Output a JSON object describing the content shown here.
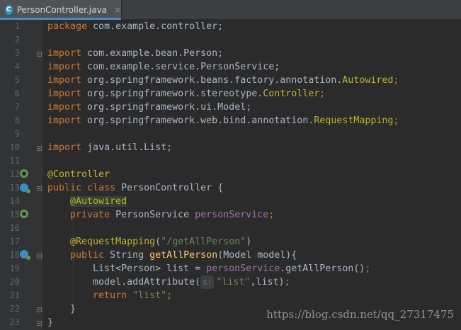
{
  "tab": {
    "icon": "C",
    "label": "PersonController.java",
    "close": "×"
  },
  "code": {
    "line_numbers": [
      "1",
      "2",
      "3",
      "4",
      "5",
      "6",
      "7",
      "8",
      "9",
      "10",
      "11",
      "12",
      "13",
      "14",
      "15",
      "16",
      "17",
      "18",
      "19",
      "20",
      "21",
      "22",
      "23"
    ],
    "l1": {
      "kw": "package",
      "rest": " com.example.controller;"
    },
    "l3": {
      "kw": "import",
      "rest": " com.example.bean.Person;"
    },
    "l4": {
      "kw": "import",
      "rest": " com.example.service.PersonService;"
    },
    "l5": {
      "kw": "import",
      "rest": " org.springframework.beans.factory.annotation.",
      "cls": "Autowired",
      "end": ";"
    },
    "l6": {
      "kw": "import",
      "rest": " org.springframework.stereotype.",
      "cls": "Controller",
      "end": ";"
    },
    "l7": {
      "kw": "import",
      "rest": " org.springframework.ui.Model;"
    },
    "l8": {
      "kw": "import",
      "rest": " org.springframework.web.bind.annotation.",
      "cls": "RequestMapping",
      "end": ";"
    },
    "l10": {
      "kw": "import",
      "rest": " java.util.List;"
    },
    "l12": {
      "ann": "@Controller"
    },
    "l13": {
      "kw1": "public",
      "kw2": " class",
      "rest": " PersonController {"
    },
    "l14": {
      "ann": "@Autowired"
    },
    "l15": {
      "kw": "private",
      "type": " PersonService ",
      "field": "personService",
      "end": ";"
    },
    "l17": {
      "ann": "@RequestMapping",
      "open": "(",
      "str": "\"/getAllPerson\"",
      "close": ")"
    },
    "l18": {
      "kw": "public",
      "type": " String ",
      "method": "getAllPerson",
      "rest": "(Model model){"
    },
    "l19": {
      "pre": "List<Person> list = ",
      "field": "personService",
      "rest": ".getAllPerson()",
      "end": ";"
    },
    "l20": {
      "pre": "model.addAttribute(",
      "hint": "s:",
      "str": "\"list\"",
      "rest": ",list)",
      "end": ";"
    },
    "l21": {
      "kw": "return",
      "str": " \"list\"",
      "end": ";"
    },
    "l22": {
      "text": "}"
    },
    "l23": {
      "text": "}"
    }
  },
  "watermark": "https://blog.csdn.net/qq_27317475",
  "colors": {
    "keyword": "#cc7832",
    "annotation": "#bbb529",
    "string": "#6a8759",
    "field": "#9876aa",
    "method": "#ffc66d",
    "text": "#a9b7c6"
  },
  "gutter_icons": [
    "bean-icon",
    "class-icon",
    "bean-icon",
    "method-icon"
  ]
}
